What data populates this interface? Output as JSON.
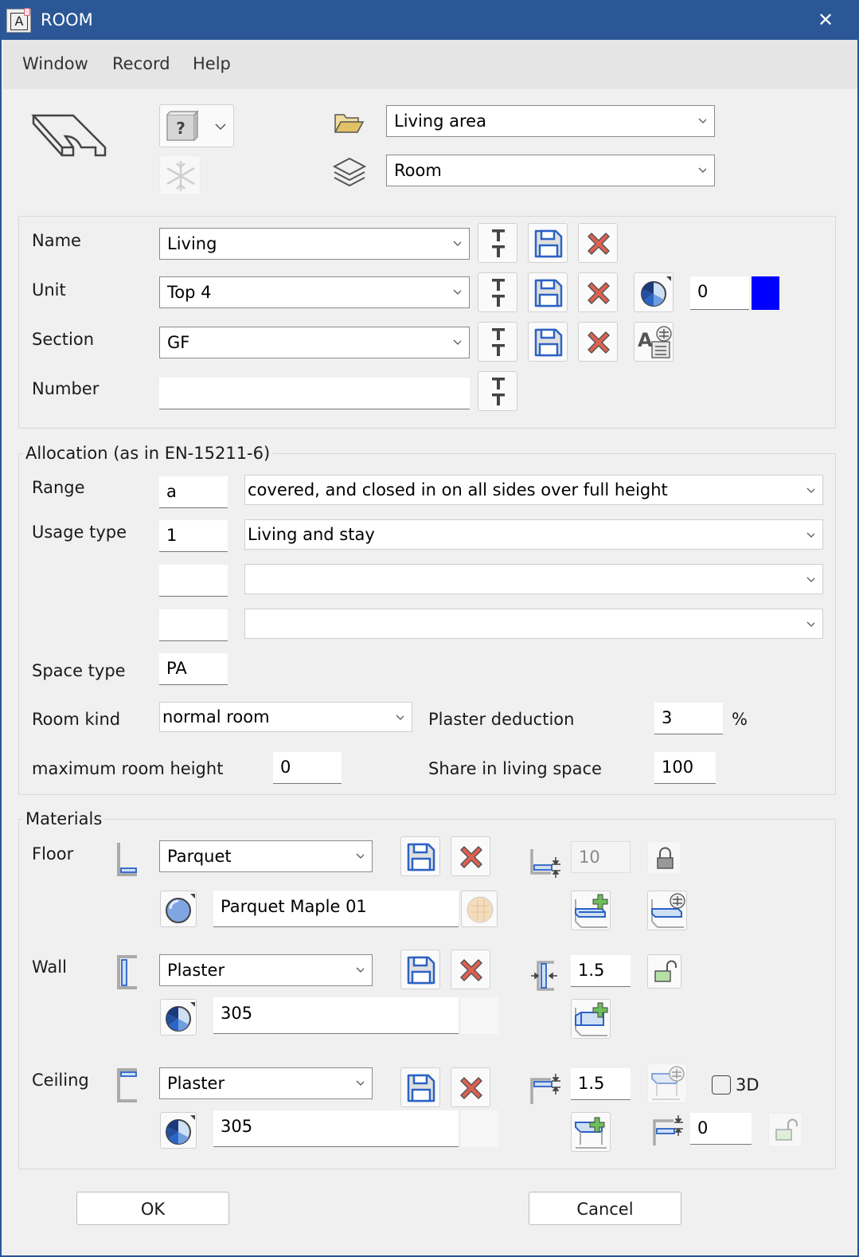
{
  "window": {
    "title": "ROOM",
    "app_icon_letter": "A",
    "close_glyph": "✕"
  },
  "menu": [
    "Window",
    "Record",
    "Help"
  ],
  "top": {
    "folder_combo": "Living area",
    "layer_combo": "Room"
  },
  "identity": {
    "name_label": "Name",
    "name_value": "Living",
    "unit_label": "Unit",
    "unit_value": "Top 4",
    "section_label": "Section",
    "section_value": "GF",
    "number_label": "Number",
    "number_value": "",
    "color_index": "0",
    "color_swatch": "#0000ff"
  },
  "allocation": {
    "title": "Allocation (as in EN-15211-6)",
    "range_label": "Range",
    "range_code": "a",
    "range_text": "covered, and closed in on all sides over full height",
    "usage_label": "Usage type",
    "usage_code": "1",
    "usage_text": "Living and stay",
    "usage2_code": "",
    "usage2_text": "",
    "usage3_code": "",
    "usage3_text": "",
    "space_type_label": "Space type",
    "space_type_value": "PA",
    "room_kind_label": "Room kind",
    "room_kind_value": "normal room",
    "plaster_label": "Plaster deduction",
    "plaster_value": "3",
    "plaster_unit": "%",
    "max_height_label": "maximum room height",
    "max_height_value": "0",
    "share_label": "Share in living space",
    "share_value": "100"
  },
  "materials": {
    "title": "Materials",
    "floor": {
      "label": "Floor",
      "material": "Parquet",
      "surface": "Parquet Maple 01",
      "thickness": "10"
    },
    "wall": {
      "label": "Wall",
      "material": "Plaster",
      "surface": "305",
      "thickness": "1.5"
    },
    "ceiling": {
      "label": "Ceiling",
      "material": "Plaster",
      "surface": "305",
      "thickness": "1.5",
      "offset": "0",
      "checkbox_3d_label": "3D",
      "checkbox_3d_checked": false
    }
  },
  "buttons": {
    "ok": "OK",
    "cancel": "Cancel"
  },
  "icons": {
    "tt": "T"
  }
}
